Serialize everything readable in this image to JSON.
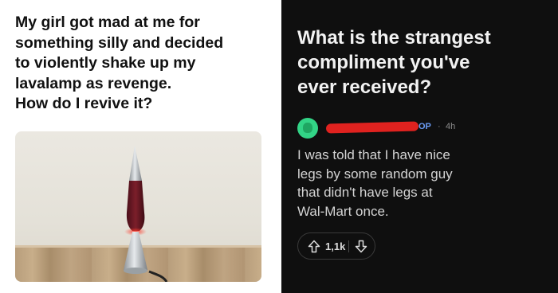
{
  "left_post": {
    "title_lines": [
      "My girl got mad at me for",
      "something silly and decided",
      "to violently shake up my",
      "lavalamp as revenge.",
      "How do I revive it?"
    ],
    "photo_icon": "lava-lamp-photo"
  },
  "right_post": {
    "title_lines": [
      "What is the strangest",
      "compliment you've",
      "ever received?"
    ],
    "comment": {
      "avatar_icon": "snoo-avatar-icon",
      "op_badge": "OP",
      "separator": "·",
      "time": "4h",
      "body_lines": [
        "I was told that I have nice",
        "legs by some random guy",
        "that didn't have legs at",
        "Wal-Mart once."
      ],
      "vote_count": "1,1k"
    }
  },
  "colors": {
    "left_bg": "#ffffff",
    "right_bg": "#0f0f0f",
    "redaction": "#e0221f",
    "op_blue": "#6b9cf5",
    "avatar_green": "#32d486"
  }
}
